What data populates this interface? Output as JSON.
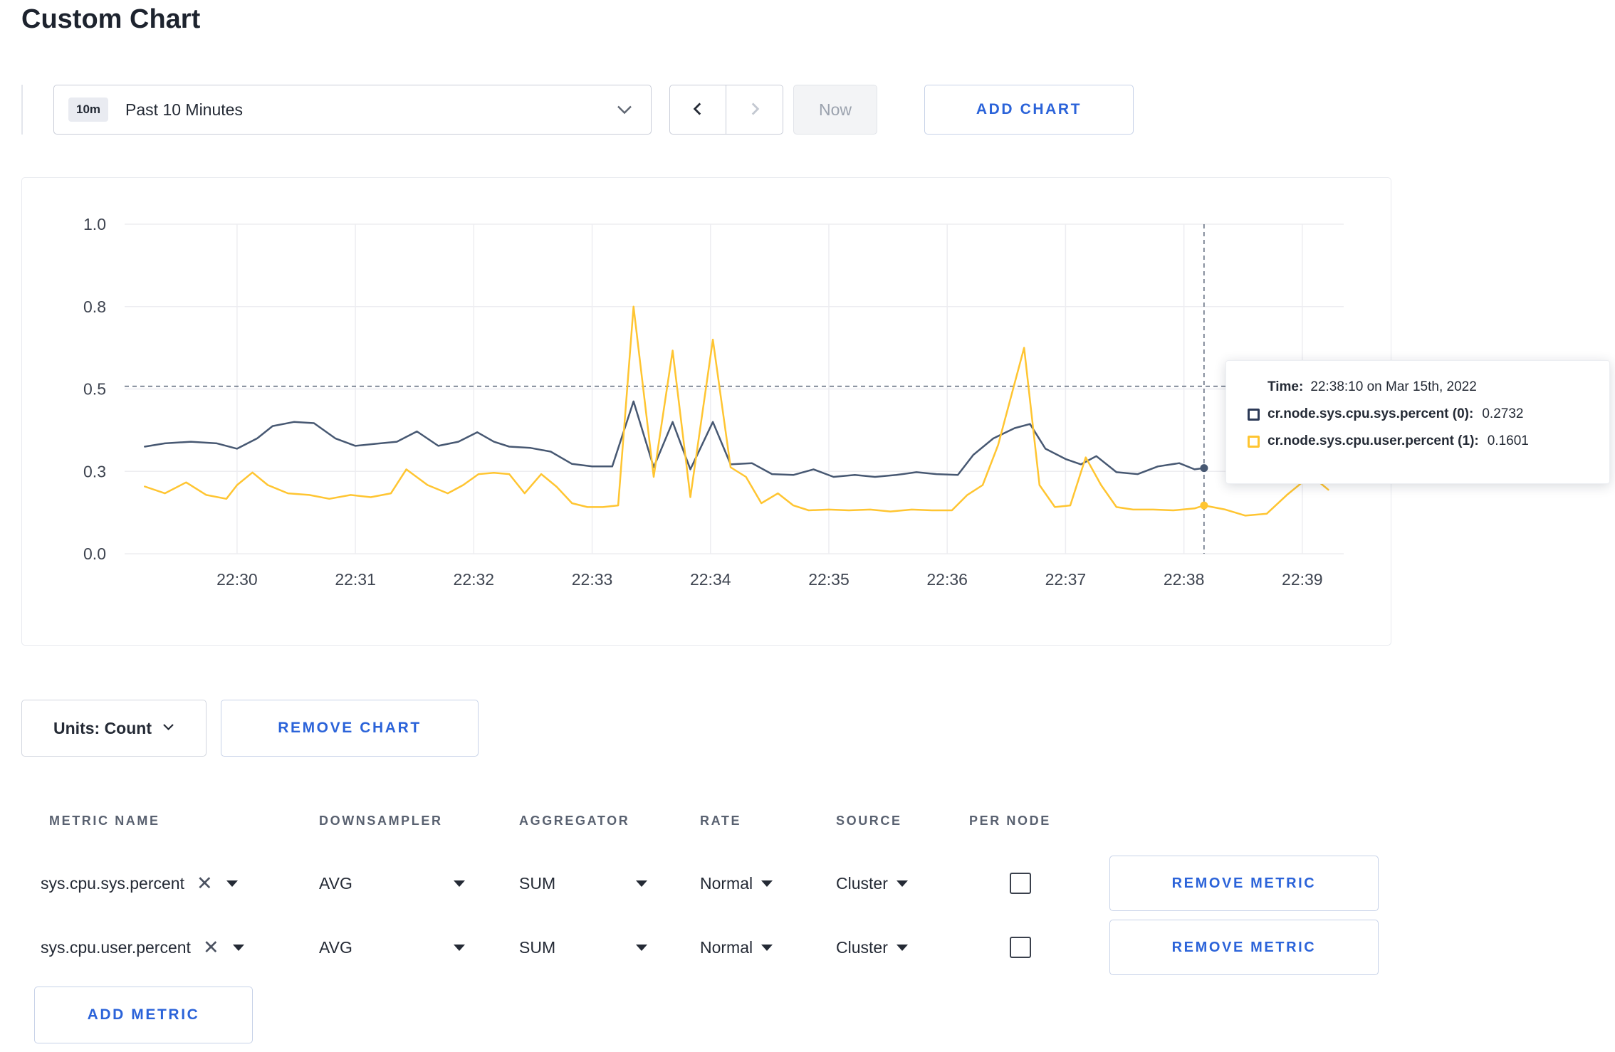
{
  "colors": {
    "accent": "#2b63d9",
    "series_sys": "#475872",
    "series_user": "#ffc531",
    "grid": "#ededf1",
    "crosshair": "#5a6578",
    "axis_text": "#3e4450"
  },
  "page": {
    "title": "Custom Chart"
  },
  "toolbar": {
    "time_badge": "10m",
    "time_range_label": "Past 10 Minutes",
    "now_label": "Now",
    "add_chart_label": "ADD CHART"
  },
  "chart_data": {
    "type": "line",
    "title": "",
    "xlabel": "",
    "ylabel": "",
    "legend_position": "tooltip",
    "grid": true,
    "x_ticks": [
      "22:30",
      "22:31",
      "22:32",
      "22:33",
      "22:34",
      "22:35",
      "22:36",
      "22:37",
      "22:38",
      "22:39"
    ],
    "x_tick_minutes": [
      30,
      31,
      32,
      33,
      34,
      35,
      36,
      37,
      38,
      39
    ],
    "x_domain_minutes": [
      29.05,
      39.35
    ],
    "y_ticks": [
      0.0,
      0.3,
      0.5,
      0.8,
      1.0
    ],
    "y_tick_labels": [
      "0.0",
      "0.3",
      "0.5",
      "0.8",
      "1.0"
    ],
    "crosshair": {
      "t": 38.17,
      "value": 0.51
    },
    "series": [
      {
        "name": "cr.node.sys.cpu.sys.percent",
        "color": "#475872",
        "points": [
          [
            29.22,
            0.36
          ],
          [
            29.39,
            0.368
          ],
          [
            29.61,
            0.372
          ],
          [
            29.83,
            0.368
          ],
          [
            30.0,
            0.355
          ],
          [
            30.17,
            0.38
          ],
          [
            30.3,
            0.41
          ],
          [
            30.48,
            0.42
          ],
          [
            30.65,
            0.417
          ],
          [
            30.83,
            0.38
          ],
          [
            31.0,
            0.362
          ],
          [
            31.17,
            0.367
          ],
          [
            31.35,
            0.372
          ],
          [
            31.52,
            0.397
          ],
          [
            31.7,
            0.362
          ],
          [
            31.87,
            0.372
          ],
          [
            32.03,
            0.395
          ],
          [
            32.17,
            0.372
          ],
          [
            32.3,
            0.36
          ],
          [
            32.48,
            0.357
          ],
          [
            32.65,
            0.348
          ],
          [
            32.83,
            0.318
          ],
          [
            33.0,
            0.312
          ],
          [
            33.17,
            0.312
          ],
          [
            33.35,
            0.47
          ],
          [
            33.52,
            0.31
          ],
          [
            33.68,
            0.42
          ],
          [
            33.83,
            0.305
          ],
          [
            34.02,
            0.42
          ],
          [
            34.17,
            0.317
          ],
          [
            34.35,
            0.32
          ],
          [
            34.52,
            0.29
          ],
          [
            34.7,
            0.287
          ],
          [
            34.87,
            0.305
          ],
          [
            35.04,
            0.28
          ],
          [
            35.22,
            0.287
          ],
          [
            35.39,
            0.28
          ],
          [
            35.57,
            0.287
          ],
          [
            35.74,
            0.297
          ],
          [
            35.91,
            0.29
          ],
          [
            36.09,
            0.287
          ],
          [
            36.22,
            0.34
          ],
          [
            36.39,
            0.38
          ],
          [
            36.57,
            0.405
          ],
          [
            36.7,
            0.415
          ],
          [
            36.83,
            0.355
          ],
          [
            37.0,
            0.33
          ],
          [
            37.13,
            0.317
          ],
          [
            37.26,
            0.337
          ],
          [
            37.43,
            0.297
          ],
          [
            37.61,
            0.29
          ],
          [
            37.78,
            0.312
          ],
          [
            37.96,
            0.32
          ],
          [
            38.09,
            0.305
          ],
          [
            38.17,
            0.308
          ]
        ]
      },
      {
        "name": "cr.node.sys.cpu.user.percent",
        "color": "#ffc531",
        "points": [
          [
            29.22,
            0.245
          ],
          [
            29.39,
            0.22
          ],
          [
            29.57,
            0.26
          ],
          [
            29.74,
            0.214
          ],
          [
            29.91,
            0.2
          ],
          [
            30.0,
            0.25
          ],
          [
            30.13,
            0.296
          ],
          [
            30.26,
            0.25
          ],
          [
            30.43,
            0.22
          ],
          [
            30.61,
            0.214
          ],
          [
            30.78,
            0.2
          ],
          [
            30.96,
            0.214
          ],
          [
            31.13,
            0.206
          ],
          [
            31.3,
            0.22
          ],
          [
            31.43,
            0.305
          ],
          [
            31.61,
            0.25
          ],
          [
            31.78,
            0.22
          ],
          [
            31.91,
            0.25
          ],
          [
            32.04,
            0.29
          ],
          [
            32.17,
            0.295
          ],
          [
            32.3,
            0.29
          ],
          [
            32.43,
            0.22
          ],
          [
            32.57,
            0.29
          ],
          [
            32.7,
            0.244
          ],
          [
            32.83,
            0.184
          ],
          [
            32.96,
            0.17
          ],
          [
            33.09,
            0.17
          ],
          [
            33.22,
            0.176
          ],
          [
            33.35,
            0.8
          ],
          [
            33.52,
            0.28
          ],
          [
            33.68,
            0.64
          ],
          [
            33.83,
            0.206
          ],
          [
            34.02,
            0.68
          ],
          [
            34.17,
            0.31
          ],
          [
            34.3,
            0.28
          ],
          [
            34.43,
            0.184
          ],
          [
            34.57,
            0.22
          ],
          [
            34.7,
            0.176
          ],
          [
            34.83,
            0.158
          ],
          [
            35.0,
            0.161
          ],
          [
            35.17,
            0.158
          ],
          [
            35.35,
            0.161
          ],
          [
            35.52,
            0.154
          ],
          [
            35.7,
            0.161
          ],
          [
            35.87,
            0.158
          ],
          [
            36.04,
            0.158
          ],
          [
            36.17,
            0.214
          ],
          [
            36.3,
            0.25
          ],
          [
            36.43,
            0.364
          ],
          [
            36.65,
            0.65
          ],
          [
            36.78,
            0.25
          ],
          [
            36.91,
            0.17
          ],
          [
            37.04,
            0.176
          ],
          [
            37.17,
            0.334
          ],
          [
            37.3,
            0.25
          ],
          [
            37.43,
            0.17
          ],
          [
            37.57,
            0.161
          ],
          [
            37.74,
            0.161
          ],
          [
            37.91,
            0.158
          ],
          [
            38.09,
            0.165
          ],
          [
            38.17,
            0.176
          ],
          [
            38.35,
            0.161
          ],
          [
            38.52,
            0.139
          ],
          [
            38.7,
            0.146
          ],
          [
            38.87,
            0.214
          ],
          [
            39.0,
            0.26
          ],
          [
            39.09,
            0.28
          ],
          [
            39.22,
            0.233
          ]
        ]
      }
    ]
  },
  "tooltip": {
    "time_label": "Time:",
    "time_value": "22:38:10 on Mar 15th, 2022",
    "rows": [
      {
        "label": "cr.node.sys.cpu.sys.percent (0):",
        "value": "0.2732",
        "swatch": "#2c3a57"
      },
      {
        "label": "cr.node.sys.cpu.user.percent (1):",
        "value": "0.1601",
        "swatch": "#ffc531"
      }
    ]
  },
  "chart_controls": {
    "units_label": "Units: Count",
    "remove_chart_label": "REMOVE CHART",
    "add_metric_label": "ADD METRIC"
  },
  "metrics_table": {
    "headers": [
      "METRIC NAME",
      "DOWNSAMPLER",
      "AGGREGATOR",
      "RATE",
      "SOURCE",
      "PER NODE"
    ],
    "rows": [
      {
        "metric": "sys.cpu.sys.percent",
        "downsampler": "AVG",
        "aggregator": "SUM",
        "rate": "Normal",
        "source": "Cluster",
        "per_node": false,
        "remove_label": "REMOVE METRIC"
      },
      {
        "metric": "sys.cpu.user.percent",
        "downsampler": "AVG",
        "aggregator": "SUM",
        "rate": "Normal",
        "source": "Cluster",
        "per_node": false,
        "remove_label": "REMOVE METRIC"
      }
    ]
  }
}
